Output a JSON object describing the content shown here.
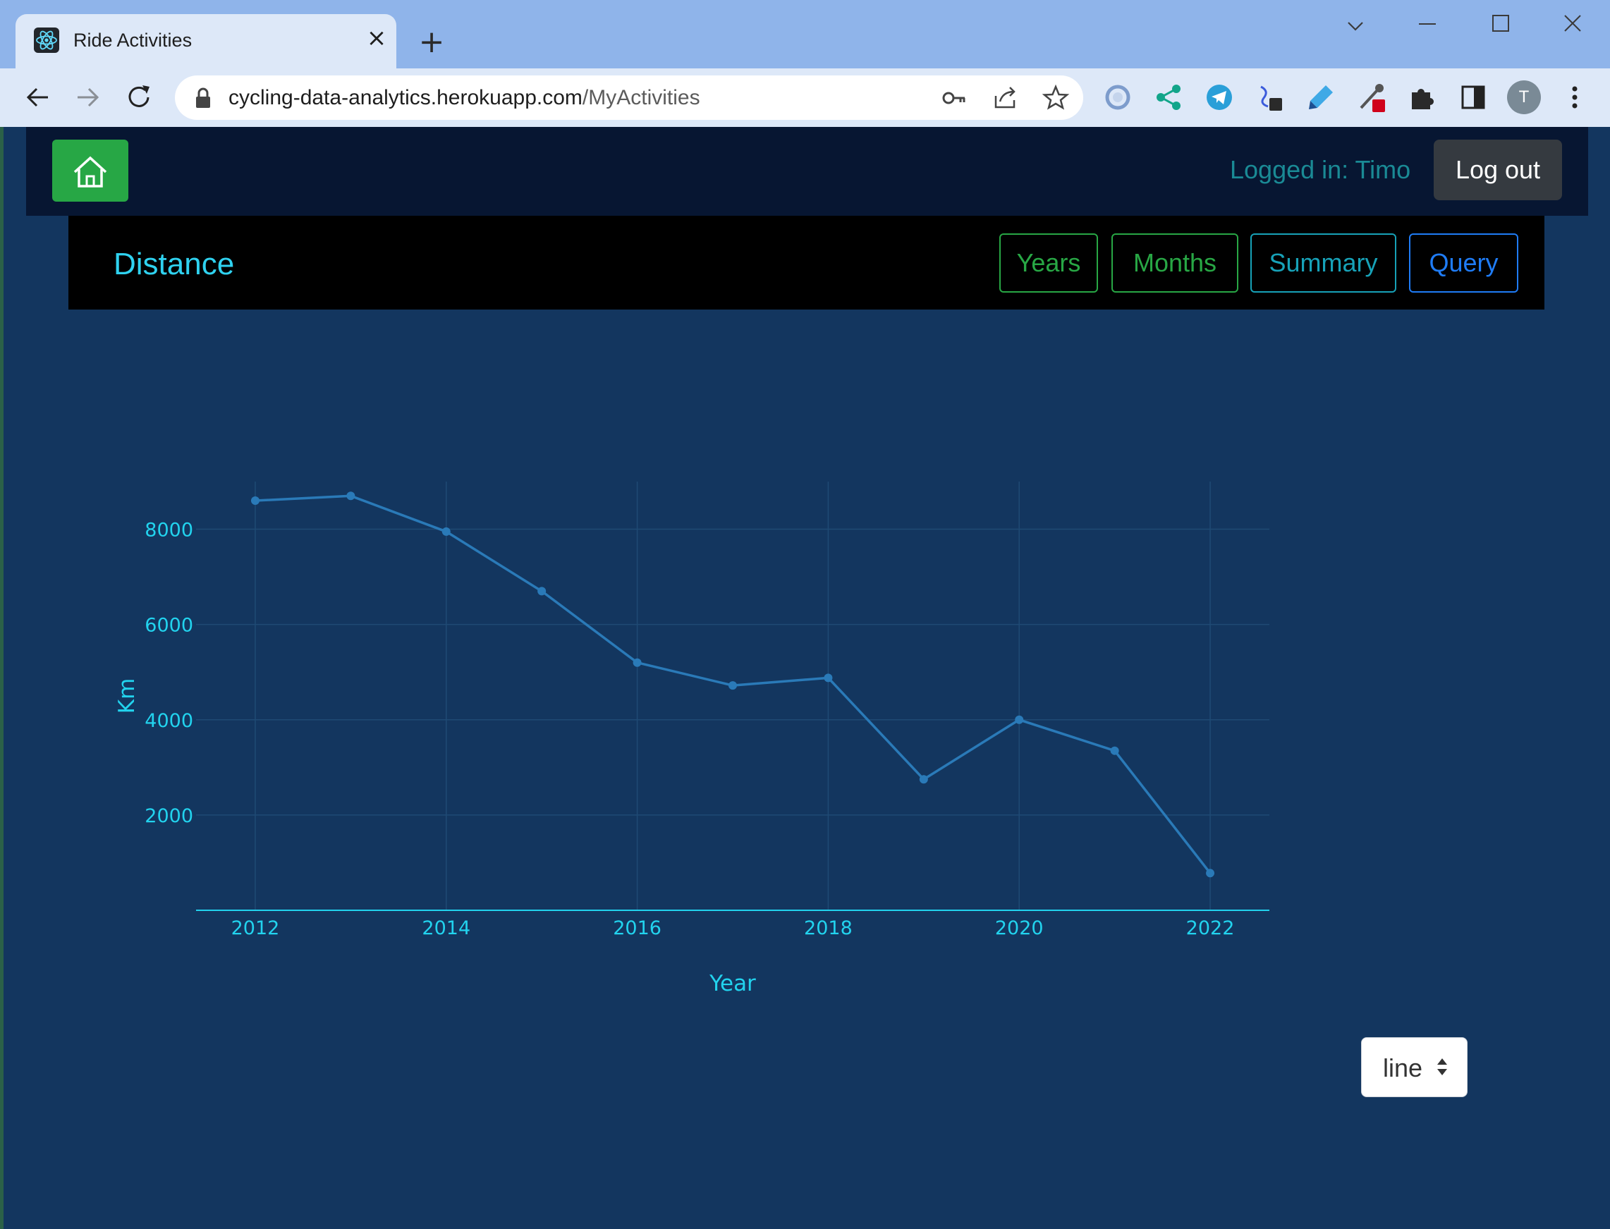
{
  "browser": {
    "tab_title": "Ride Activities",
    "tab_close": "×",
    "new_tab": "+",
    "url_host": "cycling-data-analytics.herokuapp.com",
    "url_path": "/MyActivities",
    "avatar_letter": "T"
  },
  "header": {
    "logged_in": "Logged in: Timo",
    "logout_label": "Log out"
  },
  "subnav": {
    "title": "Distance",
    "tabs": [
      {
        "label": "Years",
        "color": "#28a745"
      },
      {
        "label": "Months",
        "color": "#28a745"
      },
      {
        "label": "Summary",
        "color": "#17a2b8"
      },
      {
        "label": "Query",
        "color": "#1f7cf6"
      }
    ]
  },
  "chart_type_select": {
    "selected": "line"
  },
  "colors": {
    "page_bg": "#13365f",
    "line": "#2a7ab8",
    "axis_text": "#22d3ee",
    "grid": "#1f4a74"
  },
  "chart_data": {
    "type": "line",
    "x": [
      2012,
      2013,
      2014,
      2015,
      2016,
      2017,
      2018,
      2019,
      2020,
      2021,
      2022
    ],
    "series": [
      {
        "values": [
          8600,
          8700,
          7950,
          6700,
          5200,
          4720,
          4880,
          2750,
          4000,
          3350,
          780
        ]
      }
    ],
    "xlabel": "Year",
    "ylabel": "Km",
    "xticks": [
      2012,
      2014,
      2016,
      2018,
      2020,
      2022
    ],
    "yticks": [
      2000,
      4000,
      6000,
      8000
    ],
    "xlim": [
      2011.38,
      2022.62
    ],
    "ylim": [
      0,
      9000
    ],
    "grid": true,
    "markers": true
  }
}
